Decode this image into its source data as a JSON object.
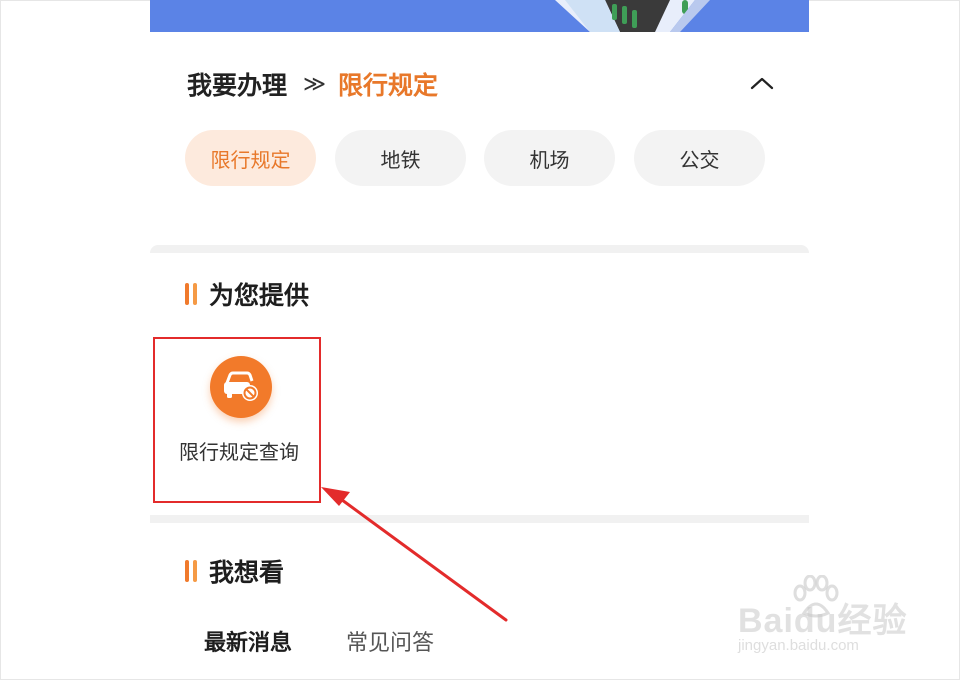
{
  "handle": {
    "title": "我要办理",
    "separator": "≫",
    "current": "限行规定"
  },
  "tabs": [
    {
      "label": "限行规定",
      "active": true
    },
    {
      "label": "地铁",
      "active": false
    },
    {
      "label": "机场",
      "active": false
    },
    {
      "label": "公交",
      "active": false
    }
  ],
  "provide": {
    "heading": "为您提供",
    "services": [
      {
        "label": "限行规定查询",
        "icon": "car-restricted-icon"
      }
    ]
  },
  "want_to_see": {
    "heading": "我想看",
    "tabs": [
      {
        "label": "最新消息",
        "active": true
      },
      {
        "label": "常见问答",
        "active": false
      }
    ]
  },
  "watermark": {
    "brand": "Baidu经验",
    "url": "jingyan.baidu.com"
  },
  "colors": {
    "accent": "#e8782a",
    "banner": "#5b83e6",
    "highlight_box": "#e32b2b"
  }
}
